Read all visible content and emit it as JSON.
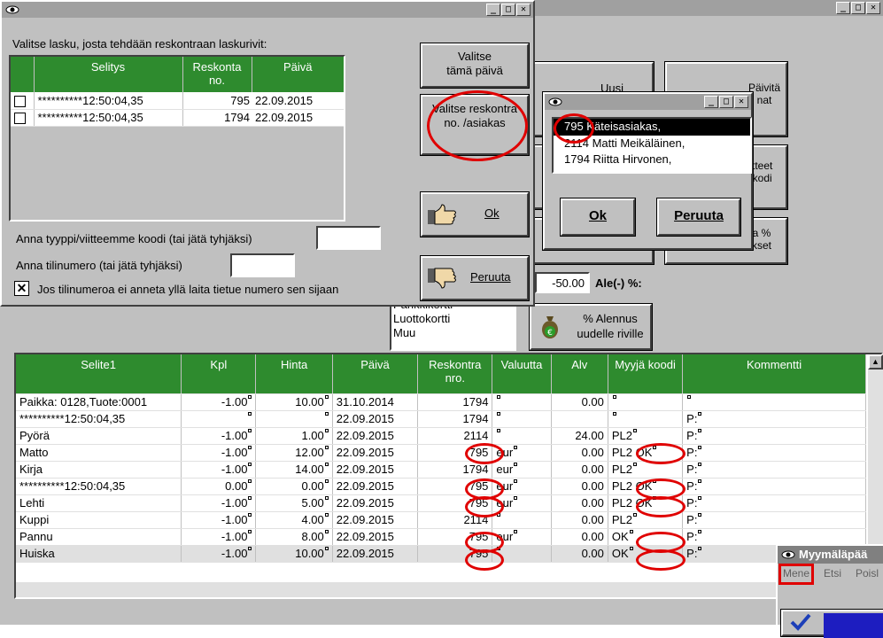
{
  "main_window": {
    "caption_buttons": [
      "_",
      "□",
      "✕"
    ]
  },
  "invoice_dialog": {
    "caption_buttons": [
      "_",
      "□",
      "✕"
    ],
    "prompt": "Valitse lasku, josta tehdään reskontraan laskurivit:",
    "table_headers": [
      "Selitys",
      "Reskonta no.",
      "Päivä"
    ],
    "rows": [
      {
        "selitys": "**********12:50:04,35",
        "reskontra": "795",
        "paiva": "22.09.2015"
      },
      {
        "selitys": "**********12:50:04,35",
        "reskontra": "1794",
        "paiva": "22.09.2015"
      }
    ],
    "btn_today": "Valitse tämä päivä",
    "btn_reskontra": "Valitse reskontra no. /asiakas",
    "btn_ok": "Ok",
    "btn_cancel": "Peruuta",
    "type_label": "Anna tyyppi/viitteemme koodi (tai jätä tyhjäksi)",
    "account_label": "Anna tilinumero (tai jätä tyhjäksi)",
    "checkbox_label": "Jos tilinumeroa ei anneta yllä laita tietue numero sen sijaan",
    "checkbox_mark": "✕"
  },
  "customer_dialog": {
    "caption_buttons": [
      "_",
      "□",
      "✕"
    ],
    "items": [
      "795 Käteisasiakas,",
      "2114 Matti Meikäläinen,",
      "1794 Riitta Hirvonen,"
    ],
    "btn_ok": "Ok",
    "btn_cancel": "Peruuta"
  },
  "background": {
    "btn_uusi_fragment": "Uusi",
    "btn_paivita_fragment": "Päivitä\nnat",
    "btn_tteet_fragment": "tteet\nkodi",
    "btn_pct_fragment": "a %\nkset",
    "discount_value": "-50.00",
    "discount_label": "Ale(-) %:",
    "payment_methods": [
      "Pankkikortti",
      "Luottokortti",
      "Muu"
    ],
    "pct_button": "% Alennus uudelle riville"
  },
  "sales_table": {
    "headers": [
      "Selite1",
      "Kpl",
      "Hinta",
      "Päivä",
      "Reskontra nro.",
      "Valuutta",
      "Alv",
      "Myyjä koodi",
      "Kommentti"
    ],
    "rows": [
      [
        "Paikka: 0128,Tuote:0001",
        "-1.00",
        "10.00",
        "31.10.2014",
        "1794",
        "",
        "0.00",
        "",
        ""
      ],
      [
        "**********12:50:04,35",
        "",
        "",
        "22.09.2015",
        "1794",
        "",
        "",
        "",
        "P:"
      ],
      [
        "Pyörä",
        "-1.00",
        "1.00",
        "22.09.2015",
        "2114",
        "",
        "24.00",
        "PL2",
        "P:"
      ],
      [
        "Matto",
        "-1.00",
        "12.00",
        "22.09.2015",
        "795",
        "eur",
        "0.00",
        "PL2 OK",
        "P:"
      ],
      [
        "Kirja",
        "-1.00",
        "14.00",
        "22.09.2015",
        "1794",
        "eur",
        "0.00",
        "PL2",
        "P:"
      ],
      [
        "**********12:50:04,35",
        "0.00",
        "0.00",
        "22.09.2015",
        "795",
        "eur",
        "0.00",
        "PL2 OK",
        "P:"
      ],
      [
        "Lehti",
        "-1.00",
        "5.00",
        "22.09.2015",
        "795",
        "eur",
        "0.00",
        "PL2 OK",
        "P:"
      ],
      [
        "Kuppi",
        "-1.00",
        "4.00",
        "22.09.2015",
        "2114",
        "",
        "0.00",
        "PL2",
        "P:"
      ],
      [
        "Pannu",
        "-1.00",
        "8.00",
        "22.09.2015",
        "795",
        "eur",
        "0.00",
        "OK",
        "P:"
      ],
      [
        "Huiska",
        "-1.00",
        "10.00",
        "22.09.2015",
        "795",
        "",
        "0.00",
        "OK",
        "P:"
      ]
    ]
  },
  "shop_window": {
    "title": "Myymäläpää",
    "menu": [
      "Mene",
      "Etsi",
      "Poisl"
    ]
  },
  "colors": {
    "header_green": "#2e8b2e",
    "highlight_red": "#e00000",
    "selection_black": "#000000"
  }
}
